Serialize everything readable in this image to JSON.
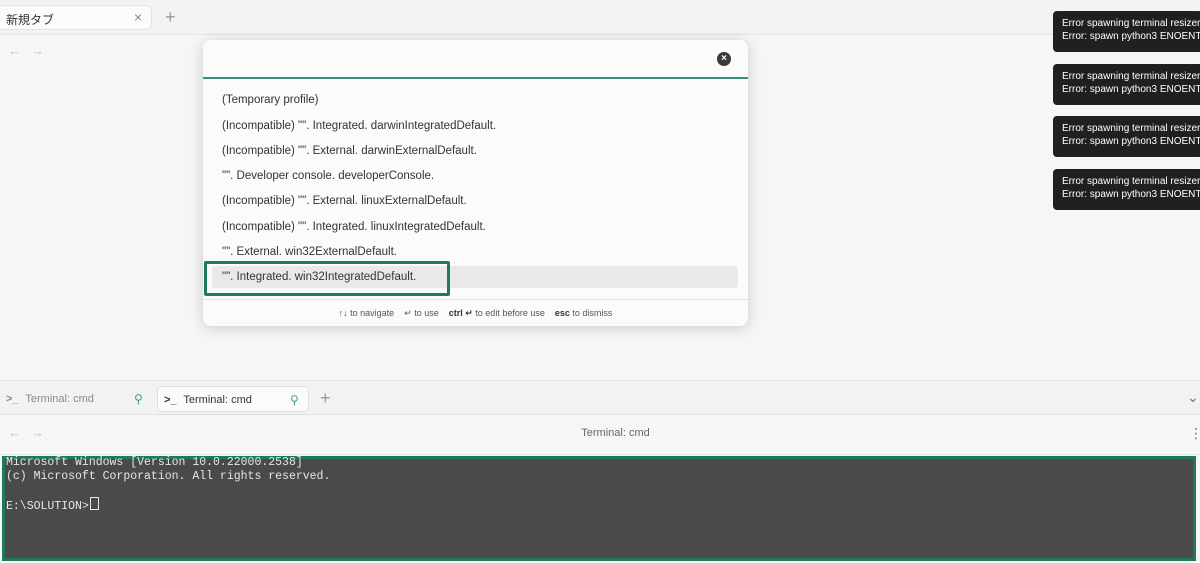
{
  "top_tab": {
    "label": "新規タブ",
    "close": "×"
  },
  "new_tab_plus": "+",
  "nav": {
    "back": "←",
    "forward": "→"
  },
  "modal": {
    "close": "×",
    "items": [
      "(Temporary profile)",
      "(Incompatible) \"\". Integrated. darwinIntegratedDefault.",
      "(Incompatible) \"\". External. darwinExternalDefault.",
      "\"\". Developer console. developerConsole.",
      "(Incompatible) \"\". External. linuxExternalDefault.",
      "(Incompatible) \"\". Integrated. linuxIntegratedDefault.",
      "\"\". External. win32ExternalDefault.",
      "\"\". Integrated. win32IntegratedDefault."
    ],
    "selected_index": 7,
    "footer": {
      "nav_keys": "↑↓",
      "nav_text": "to navigate",
      "use_key": "↵",
      "use_text": "to use",
      "edit_key": "ctrl ↵",
      "edit_text": "to edit before use",
      "dismiss_key": "esc",
      "dismiss_text": "to dismiss"
    }
  },
  "notifications": [
    {
      "line1": "Error spawning terminal resizer",
      "line2": "Error: spawn python3 ENOENT"
    },
    {
      "line1": "Error spawning terminal resizer",
      "line2": "Error: spawn python3 ENOENT"
    },
    {
      "line1": "Error spawning terminal resizer",
      "line2": "Error: spawn python3 ENOENT"
    },
    {
      "line1": "Error spawning terminal resizer",
      "line2": "Error: spawn python3 ENOENT"
    }
  ],
  "terminal_tabs": [
    {
      "prompt": ">_",
      "label": "Terminal: cmd",
      "active": false
    },
    {
      "prompt": ">_",
      "label": "Terminal: cmd",
      "active": true
    }
  ],
  "terminal_header": {
    "title": "Terminal: cmd",
    "menu": "⋮",
    "chevron": "⌄"
  },
  "terminal": {
    "lines": [
      "Microsoft Windows [Version 10.0.22000.2538]",
      "(c) Microsoft Corporation. All rights reserved.",
      "",
      "E:\\SOLUTION>"
    ]
  },
  "colors": {
    "accent": "#1e7a57",
    "modal_line": "#3a8f85",
    "terminal_bg": "#4a4a4a"
  },
  "icons": {
    "pin": "pin-icon",
    "close": "close-icon",
    "plus": "plus-icon"
  }
}
